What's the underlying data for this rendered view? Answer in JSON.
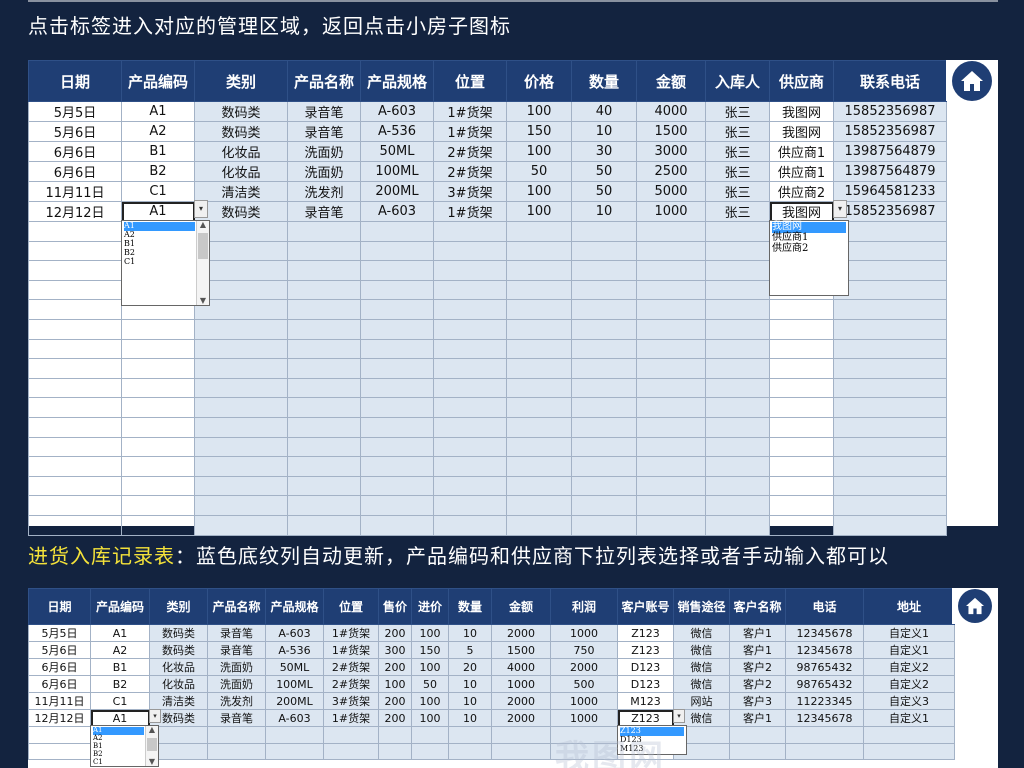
{
  "captions": {
    "top": "点击标签进入对应的管理区域，返回点击小房子图标",
    "middle_highlight": "进货入库记录表",
    "middle_rest": "：蓝色底纹列自动更新，产品编码和供应商下拉列表选择或者手动输入都可以"
  },
  "inbound": {
    "headers": [
      "日期",
      "产品编码",
      "类别",
      "产品名称",
      "产品规格",
      "位置",
      "价格",
      "数量",
      "金额",
      "入库人",
      "供应商",
      "联系电话"
    ],
    "rows": [
      [
        "5月5日",
        "A1",
        "数码类",
        "录音笔",
        "A-603",
        "1#货架",
        "100",
        "40",
        "4000",
        "张三",
        "我图网",
        "15852356987"
      ],
      [
        "5月6日",
        "A2",
        "数码类",
        "录音笔",
        "A-536",
        "1#货架",
        "150",
        "10",
        "1500",
        "张三",
        "我图网",
        "15852356987"
      ],
      [
        "6月6日",
        "B1",
        "化妆品",
        "洗面奶",
        "50ML",
        "2#货架",
        "100",
        "30",
        "3000",
        "张三",
        "供应商1",
        "13987564879"
      ],
      [
        "6月6日",
        "B2",
        "化妆品",
        "洗面奶",
        "100ML",
        "2#货架",
        "50",
        "50",
        "2500",
        "张三",
        "供应商1",
        "13987564879"
      ],
      [
        "11月11日",
        "C1",
        "清洁类",
        "洗发剂",
        "200ML",
        "3#货架",
        "100",
        "50",
        "5000",
        "张三",
        "供应商2",
        "15964581233"
      ],
      [
        "12月12日",
        "A1",
        "数码类",
        "录音笔",
        "A-603",
        "1#货架",
        "100",
        "10",
        "1000",
        "张三",
        "我图网",
        "15852356987"
      ]
    ],
    "code_dropdown": [
      "A1",
      "A2",
      "B1",
      "B2",
      "C1"
    ],
    "supplier_dropdown": [
      "我图网",
      "供应商1",
      "供应商2"
    ]
  },
  "sales": {
    "headers": [
      "日期",
      "产品编码",
      "类别",
      "产品名称",
      "产品规格",
      "位置",
      "售价",
      "进价",
      "数量",
      "金额",
      "利润",
      "客户账号",
      "销售途径",
      "客户名称",
      "电话",
      "地址"
    ],
    "rows": [
      [
        "5月5日",
        "A1",
        "数码类",
        "录音笔",
        "A-603",
        "1#货架",
        "200",
        "100",
        "10",
        "2000",
        "1000",
        "Z123",
        "微信",
        "客户1",
        "12345678",
        "自定义1"
      ],
      [
        "5月6日",
        "A2",
        "数码类",
        "录音笔",
        "A-536",
        "1#货架",
        "300",
        "150",
        "5",
        "1500",
        "750",
        "Z123",
        "微信",
        "客户1",
        "12345678",
        "自定义1"
      ],
      [
        "6月6日",
        "B1",
        "化妆品",
        "洗面奶",
        "50ML",
        "2#货架",
        "200",
        "100",
        "20",
        "4000",
        "2000",
        "D123",
        "微信",
        "客户2",
        "98765432",
        "自定义2"
      ],
      [
        "6月6日",
        "B2",
        "化妆品",
        "洗面奶",
        "100ML",
        "2#货架",
        "100",
        "50",
        "10",
        "1000",
        "500",
        "D123",
        "微信",
        "客户2",
        "98765432",
        "自定义2"
      ],
      [
        "11月11日",
        "C1",
        "清洁类",
        "洗发剂",
        "200ML",
        "3#货架",
        "200",
        "100",
        "10",
        "2000",
        "1000",
        "M123",
        "网站",
        "客户3",
        "11223345",
        "自定义3"
      ],
      [
        "12月12日",
        "A1",
        "数码类",
        "录音笔",
        "A-603",
        "1#货架",
        "200",
        "100",
        "10",
        "2000",
        "1000",
        "Z123",
        "微信",
        "客户1",
        "12345678",
        "自定义1"
      ]
    ],
    "code_dropdown": [
      "A1",
      "A2",
      "B1",
      "B2",
      "C1"
    ],
    "account_dropdown": [
      "Z123",
      "D123",
      "M123"
    ]
  },
  "watermark": "我图网",
  "icons": {
    "home": "home-icon",
    "dropdown": "chevron-down-icon"
  },
  "colors": {
    "background": "#13233f",
    "header": "#1f3e74",
    "auto_fill": "#dce6f1",
    "highlight": "#f4e23a",
    "selection": "#3399ff"
  }
}
